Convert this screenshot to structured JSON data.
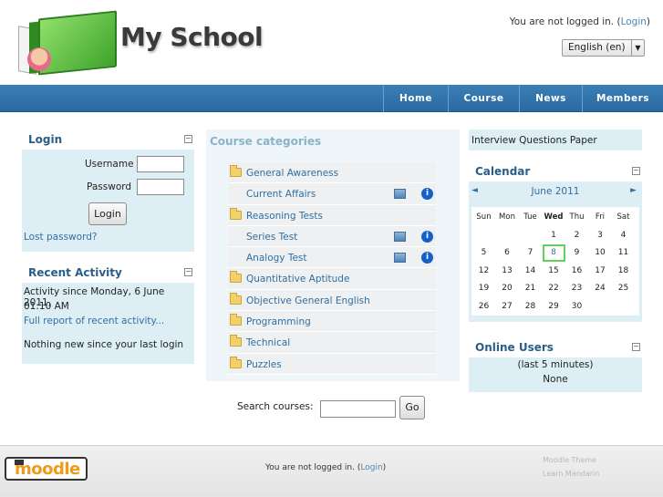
{
  "header": {
    "site_title": "My School",
    "login_text": "You are not logged in.",
    "login_link": "Login",
    "language": "English (en)"
  },
  "nav": {
    "items": [
      {
        "label": "Home"
      },
      {
        "label": "Course"
      },
      {
        "label": "News"
      },
      {
        "label": "Members"
      }
    ]
  },
  "login_block": {
    "title": "Login",
    "username_label": "Username",
    "password_label": "Password",
    "username_value": "",
    "password_value": "",
    "login_button": "Login",
    "lost_password": "Lost password?"
  },
  "recent_activity": {
    "title": "Recent Activity",
    "since_line1": "Activity since Monday, 6 June 2011,",
    "since_line2": "01:10 AM",
    "full_report": "Full report of recent activity...",
    "nothing_new": "Nothing new since your last login"
  },
  "course_categories": {
    "title": "Course categories",
    "items": [
      {
        "name": "General Awareness",
        "type": "category"
      },
      {
        "name": "Current Affairs",
        "type": "course"
      },
      {
        "name": "Reasoning Tests",
        "type": "category"
      },
      {
        "name": "Series Test",
        "type": "course"
      },
      {
        "name": "Analogy Test",
        "type": "course"
      },
      {
        "name": "Quantitative Aptitude",
        "type": "category"
      },
      {
        "name": "Objective General English",
        "type": "category"
      },
      {
        "name": "Programming",
        "type": "category"
      },
      {
        "name": "Technical",
        "type": "category"
      },
      {
        "name": "Puzzles",
        "type": "category"
      }
    ],
    "search_label": "Search courses:",
    "search_value": "",
    "go_button": "Go"
  },
  "interview_block": {
    "text": "Interview Questions Paper"
  },
  "calendar": {
    "title": "Calendar",
    "prev": "◄",
    "next": "►",
    "month": "June 2011",
    "day_headers": [
      "Sun",
      "Mon",
      "Tue",
      "Wed",
      "Thu",
      "Fri",
      "Sat"
    ],
    "weeks": [
      [
        "",
        "",
        "",
        "1",
        "2",
        "3",
        "4"
      ],
      [
        "5",
        "6",
        "7",
        "8",
        "9",
        "10",
        "11"
      ],
      [
        "12",
        "13",
        "14",
        "15",
        "16",
        "17",
        "18"
      ],
      [
        "19",
        "20",
        "21",
        "22",
        "23",
        "24",
        "25"
      ],
      [
        "26",
        "27",
        "28",
        "29",
        "30",
        "",
        ""
      ]
    ],
    "today": "8"
  },
  "online_users": {
    "title": "Online Users",
    "period": "(last 5 minutes)",
    "none": "None"
  },
  "footer": {
    "moodle_logo": "moodle",
    "login_text": "You are not logged in.",
    "login_link": "Login",
    "theme_line1": "Moodle Theme",
    "theme_line2": "Learn Mandarin"
  },
  "colors": {
    "nav_bg": "#2a6aa0",
    "block_bg": "#ddeef4",
    "link": "#2f6fa3",
    "today_border": "#5fd25f"
  }
}
